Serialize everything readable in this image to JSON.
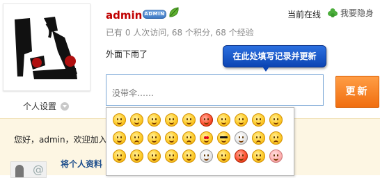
{
  "profile": {
    "username": "admin",
    "badge": "ADMIN",
    "online_status": "当前在线",
    "incognito_label": "我要隐身",
    "stats": "已有 0 人次访问, 68 个积分, 68 个经验",
    "latest_status": "外面下雨了",
    "settings_label": "个人设置"
  },
  "composer": {
    "placeholder": "没带伞……",
    "tooltip": "在此处填写记录并更新",
    "submit_label": "更新"
  },
  "welcome": {
    "text": "您好，admin，欢迎加入",
    "profile_link": "将个人资料"
  },
  "emoji_picker": {
    "rows": [
      [
        "smile-icon",
        "grin-icon",
        "laugh-icon",
        "tongue-icon",
        "wink-icon",
        "angry-icon",
        "blush-icon",
        "shy-icon",
        "sweat-icon",
        "naughty-icon"
      ],
      [
        "confused-icon",
        "cry-icon",
        "surprised-icon",
        "sleepy-icon",
        "frown-icon",
        "heart-eyes-icon",
        "cool-icon",
        "ghost-icon",
        "sad-icon",
        "worried-icon"
      ],
      [
        "dizzy-icon",
        "nervous-icon",
        "smirk-icon",
        "shocked-icon",
        "silent-icon",
        "blank-icon",
        "neutral-icon",
        "devil-icon",
        "sigh-icon",
        "pig-icon"
      ]
    ]
  },
  "colors": {
    "username": "#c00000",
    "accent_button": "#f47a1f",
    "tooltip_bg": "#1a57c8",
    "panel_bg": "#fdf6e3"
  }
}
